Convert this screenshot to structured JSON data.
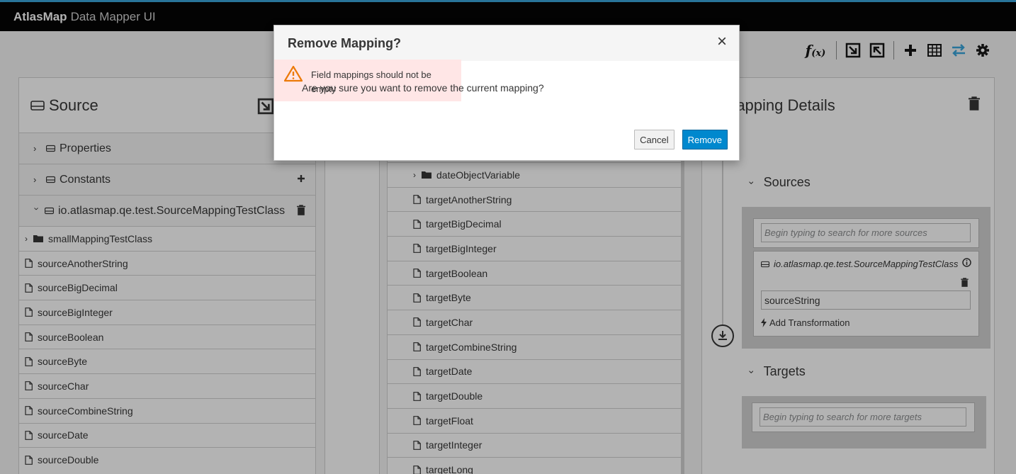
{
  "app": {
    "brand": "AtlasMap",
    "subtitle": "Data Mapper UI"
  },
  "toolbar": {
    "icons": [
      "function-icon",
      "import-icon",
      "export-icon",
      "add-icon",
      "table-icon",
      "transfer-icon",
      "gear-icon"
    ],
    "accent": "#39a5dc"
  },
  "source": {
    "title": "Source",
    "groups": [
      {
        "label": "Properties"
      },
      {
        "label": "Constants"
      },
      {
        "label": "io.atlasmap.qe.test.SourceMappingTestClass"
      }
    ],
    "folder": "smallMappingTestClass",
    "fields": [
      "sourceAnotherString",
      "sourceBigDecimal",
      "sourceBigInteger",
      "sourceBoolean",
      "sourceByte",
      "sourceChar",
      "sourceCombineString",
      "sourceDate",
      "sourceDouble"
    ]
  },
  "target": {
    "folder": "dateObjectVariable",
    "fields": [
      "targetAnotherString",
      "targetBigDecimal",
      "targetBigInteger",
      "targetBoolean",
      "targetByte",
      "targetChar",
      "targetCombineString",
      "targetDate",
      "targetDouble",
      "targetFloat",
      "targetInteger",
      "targetLong"
    ]
  },
  "details": {
    "title": "Mapping Details",
    "sources_label": "Sources",
    "targets_label": "Targets",
    "sources_placeholder": "Begin typing to search for more sources",
    "targets_placeholder": "Begin typing to search for more targets",
    "source_class": "io.atlasmap.qe.test.SourceMappingTestClass",
    "source_field": "sourceString",
    "add_transformation": "Add Transformation"
  },
  "modal": {
    "title": "Remove Mapping?",
    "close": "×",
    "alert": "Field mappings should not be empty",
    "message": "Are you sure you want to remove the current mapping?",
    "cancel": "Cancel",
    "remove": "Remove",
    "alert_color": "#ffe6e6",
    "warn_color": "#ec7a08",
    "primary_color": "#0088ce"
  }
}
